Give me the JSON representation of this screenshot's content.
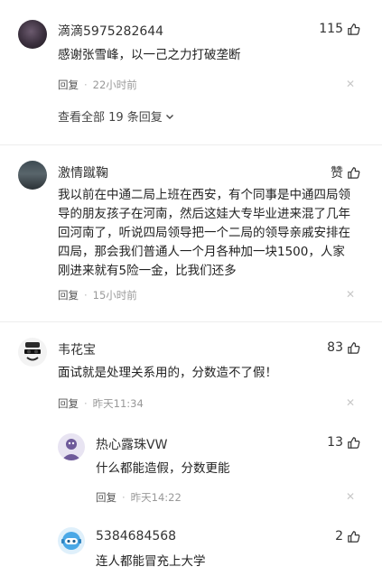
{
  "comments": [
    {
      "username": "滴滴5975282644",
      "likes": "115",
      "text": "感谢张雪峰，以一己之力打破垄断",
      "reply_label": "回复",
      "time": "22小时前",
      "view_all": "查看全部 19 条回复"
    },
    {
      "username": "激情蹴鞠",
      "likes": "赞",
      "text": "我以前在中通二局上班在西安，有个同事是中通四局领导的朋友孩子在河南，然后这娃大专毕业进来混了几年回河南了，听说四局领导把一个二局的领导亲戚安排在四局，那会我们普通人一个月各种加一块1500，人家刚进来就有5险一金，比我们还多",
      "reply_label": "回复",
      "time": "15小时前"
    },
    {
      "username": "韦花宝",
      "likes": "83",
      "text": "面试就是处理关系用的，分数造不了假！",
      "reply_label": "回复",
      "time": "昨天11:34",
      "replies": [
        {
          "username": "热心露珠VW",
          "likes": "13",
          "text": "什么都能造假，分数更能",
          "reply_label": "回复",
          "time": "昨天14:22"
        },
        {
          "username": "5384684568",
          "likes": "2",
          "text": "连人都能冒充上大学"
        }
      ]
    }
  ],
  "icons": {
    "like": "thumbs-up-icon",
    "close": "close-icon",
    "expand": "chevron-down-icon"
  }
}
